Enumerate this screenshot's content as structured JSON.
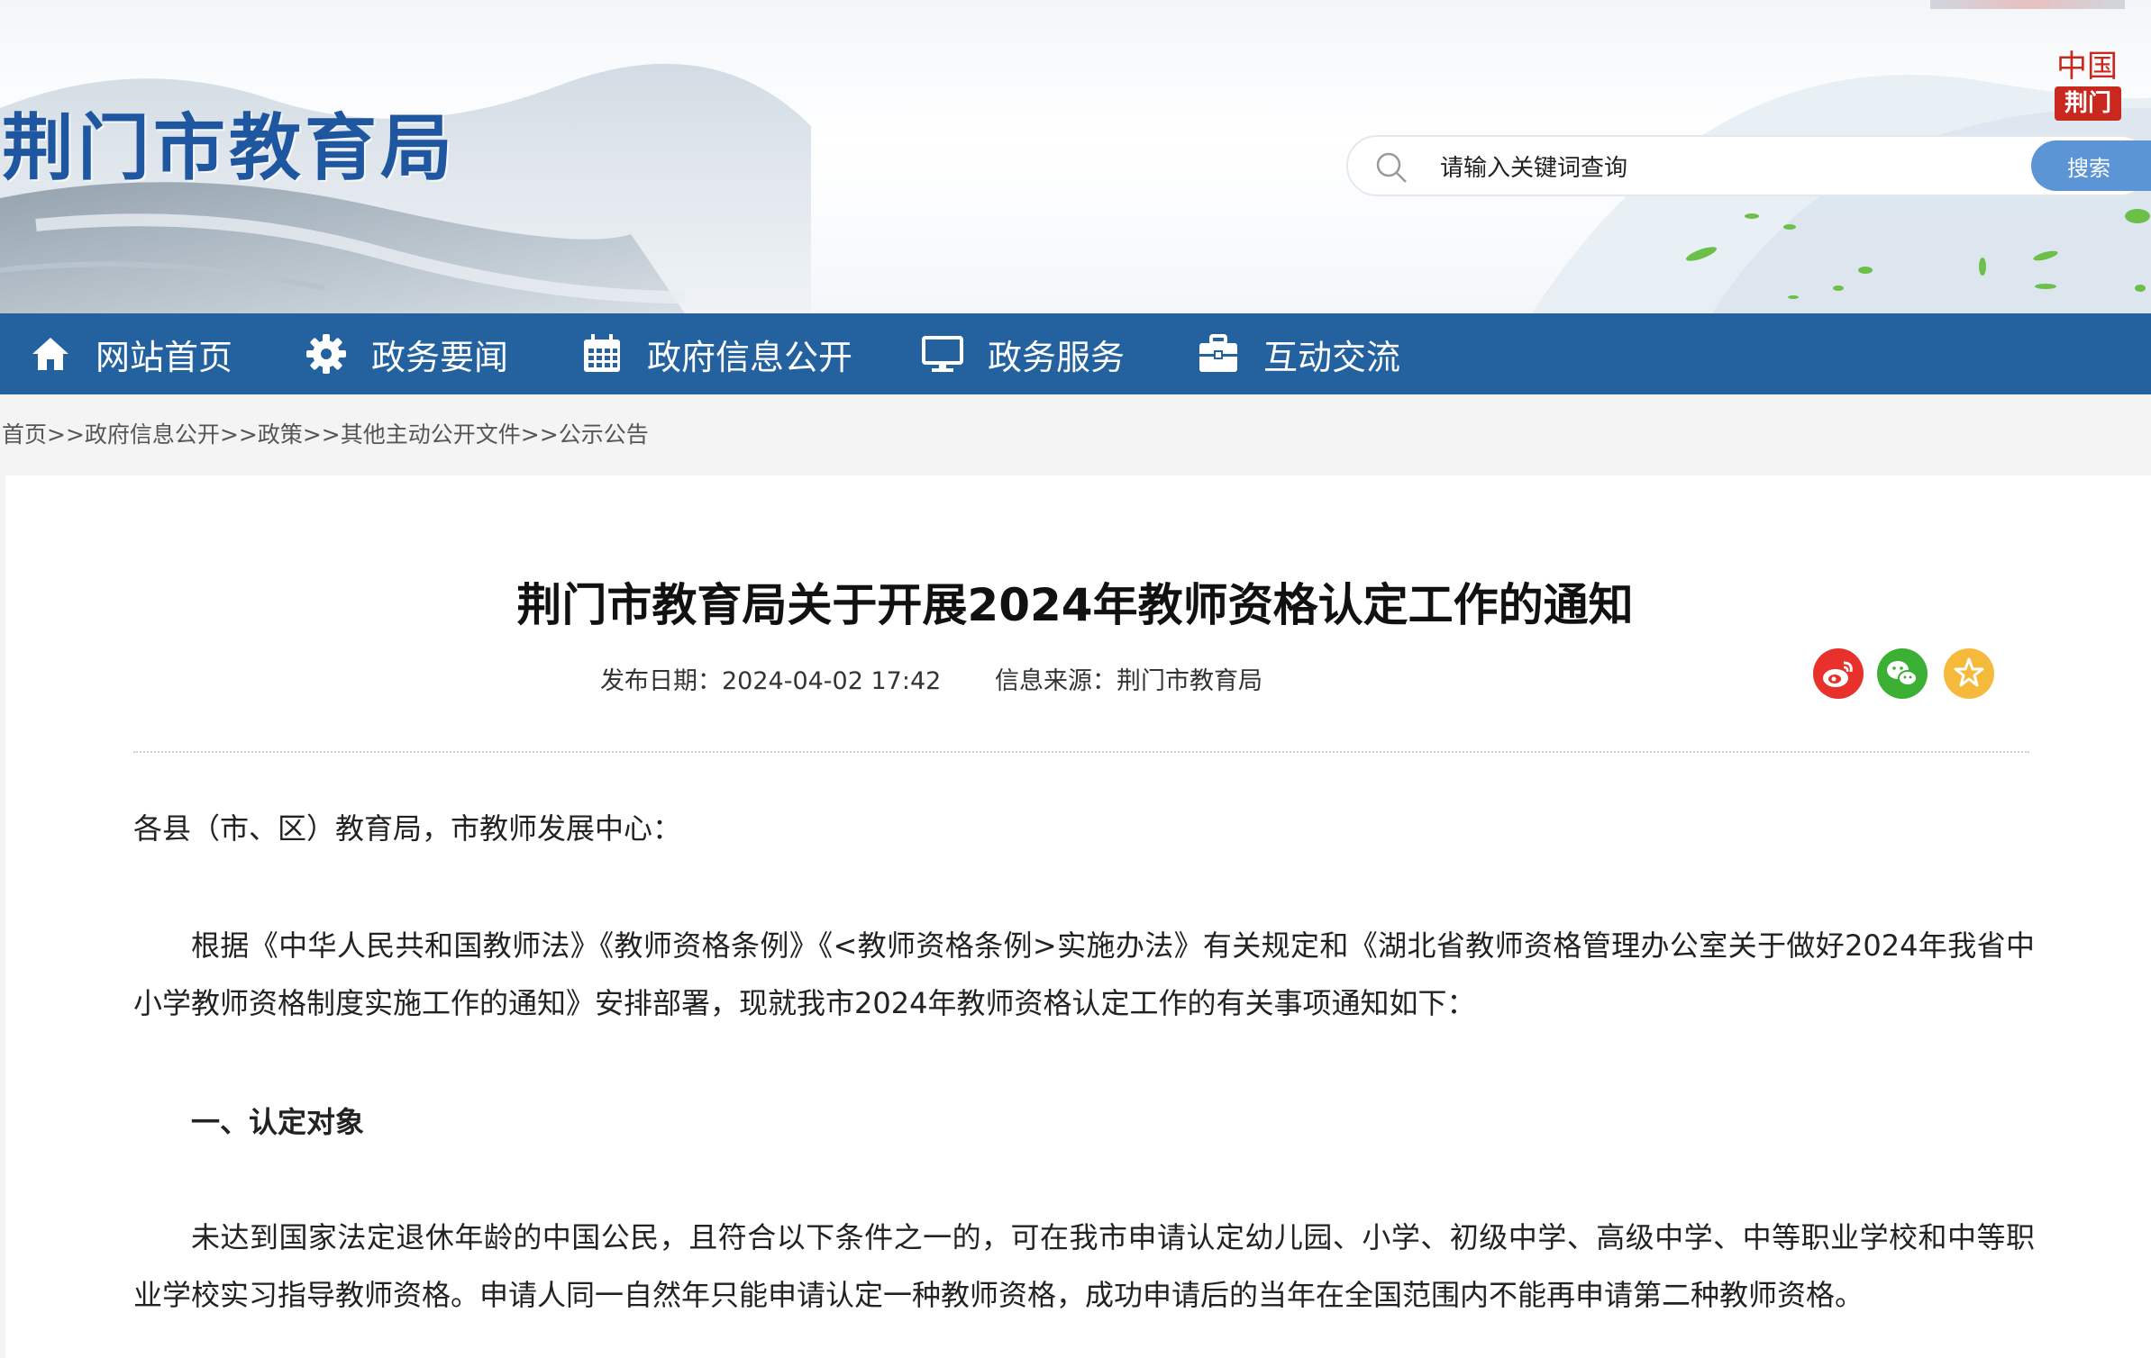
{
  "header": {
    "site_title": "荆门市教育局",
    "seal_top": "中国",
    "seal_bottom": "荆门",
    "search_placeholder": "请输入关键词查询",
    "search_button": "搜索"
  },
  "nav": [
    {
      "label": "网站首页",
      "icon": "home-icon"
    },
    {
      "label": "政务要闻",
      "icon": "gear-icon"
    },
    {
      "label": "政府信息公开",
      "icon": "calendar-icon"
    },
    {
      "label": "政务服务",
      "icon": "monitor-icon"
    },
    {
      "label": "互动交流",
      "icon": "briefcase-icon"
    }
  ],
  "breadcrumb": [
    "首页",
    "政府信息公开",
    "政策",
    "其他主动公开文件",
    "公示公告"
  ],
  "breadcrumb_separator": ">>",
  "article": {
    "title": "荆门市教育局关于开展2024年教师资格认定工作的通知",
    "publish_date": "发布日期：2024-04-02 17:42",
    "source": "信息来源：荆门市教育局",
    "share_icons": [
      "weibo-icon",
      "wechat-icon",
      "favorite-star-icon"
    ],
    "salutation": "各县（市、区）教育局，市教师发展中心：",
    "para1": "根据《中华人民共和国教师法》《教师资格条例》《<教师资格条例>实施办法》有关规定和《湖北省教师资格管理办公室关于做好2024年我省中小学教师资格制度实施工作的通知》安排部署，现就我市2024年教师资格认定工作的有关事项通知如下：",
    "section1_heading": "一、认定对象",
    "para2": "未达到国家法定退休年龄的中国公民，且符合以下条件之一的，可在我市申请认定幼儿园、小学、初级中学、高级中学、中等职业学校和中等职业学校实习指导教师资格。申请人同一自然年只能申请认定一种教师资格，成功申请后的当年在全国范围内不能再申请第二种教师资格。"
  },
  "colors": {
    "nav_bg": "#23619f",
    "logo_blue": "#1e56a0",
    "search_button": "#5b95d6",
    "weibo": "#e8312a",
    "wechat": "#3cb035",
    "star": "#f5b93c"
  }
}
